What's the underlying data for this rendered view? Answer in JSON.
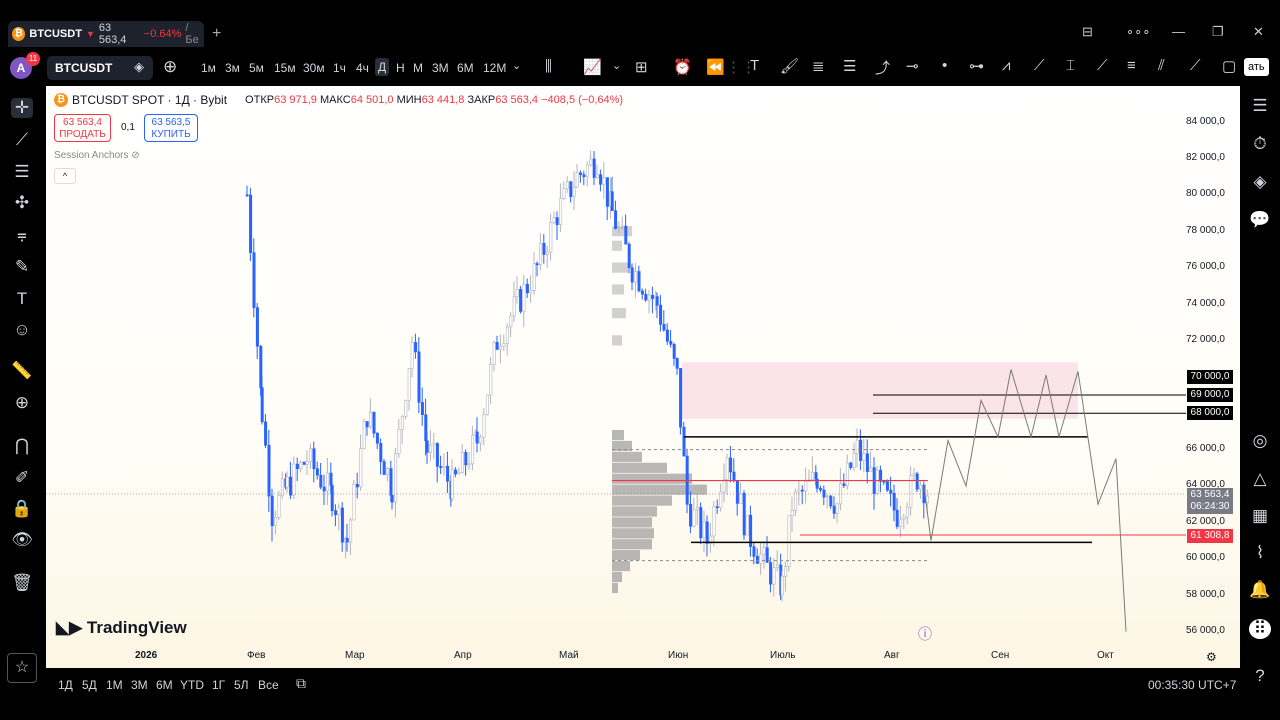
{
  "tab": {
    "symbol": "BTCUSDT",
    "price": "63 563,4",
    "change": "−0.64%",
    "extra": "/ Бе"
  },
  "toolbar": {
    "symbol": "BTCUSDT",
    "avatar": "A",
    "notif": "11",
    "timeframes": [
      "1м",
      "3м",
      "5м",
      "15м",
      "30м",
      "1ч",
      "4ч",
      "Д",
      "Н",
      "М",
      "3М",
      "6М",
      "12М"
    ],
    "selected_tf": "Д",
    "save_fragment": "ать"
  },
  "legend": {
    "title": "BTCUSDT SPOT · 1Д · Bybit",
    "open_lbl": "ОТКР",
    "open": "63 971,9",
    "high_lbl": "МАКС",
    "high": "64 501,0",
    "low_lbl": "МИН",
    "low": "63 441,8",
    "close_lbl": "ЗАКР",
    "close": "63 563,4",
    "chg": "−408,5 (−0,64%)"
  },
  "trade": {
    "sell_price": "63 563,4",
    "sell_label": "ПРОДАТЬ",
    "spread": "0,1",
    "buy_price": "63 563,5",
    "buy_label": "КУПИТЬ"
  },
  "indicator": {
    "name": "Session Anchors"
  },
  "yaxis": [
    "84 000,0",
    "82 000,0",
    "80 000,0",
    "78 000,0",
    "76 000,0",
    "74 000,0",
    "72 000,0",
    "70 000,0",
    "69 000,0",
    "68 000,0",
    "66 000,0",
    "64 000,0",
    "63 563,4",
    "06:24:30",
    "62 000,0",
    "61 308,8",
    "60 000,0",
    "58 000,0",
    "56 000,0"
  ],
  "xaxis": [
    "2026",
    "Фев",
    "Мар",
    "Апр",
    "Май",
    "Июн",
    "Июль",
    "Авг",
    "Сен",
    "Окт"
  ],
  "logo": "TradingView",
  "bottom": {
    "ranges": [
      "1Д",
      "5Д",
      "1М",
      "3М",
      "6М",
      "YTD",
      "1Г",
      "5Л",
      "Все"
    ],
    "clock": "00:35:30 UTC+7"
  },
  "colors": {
    "up": "#b2b5be",
    "down": "#2962ff",
    "level_red": "#f23645",
    "zone": "#f8d7e3"
  },
  "chart_data": {
    "type": "candlestick",
    "ylim": [
      55000,
      86000
    ],
    "levels": [
      69000,
      68000,
      61308.8
    ],
    "last_price": 63563.4
  }
}
